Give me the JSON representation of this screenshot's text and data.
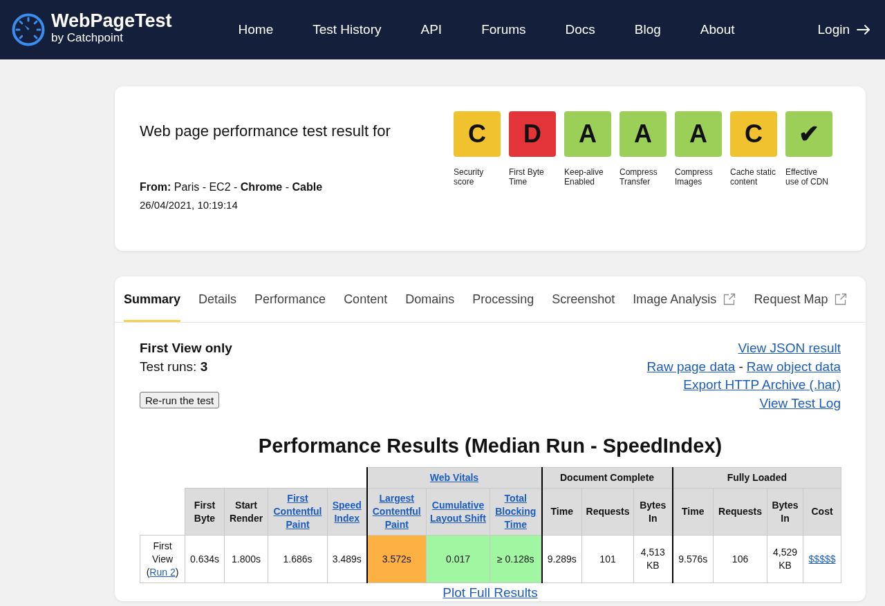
{
  "header": {
    "logo": {
      "title": "WebPageTest",
      "subtitle": "by Catchpoint"
    },
    "nav": [
      "Home",
      "Test History",
      "API",
      "Forums",
      "Docs",
      "Blog",
      "About"
    ],
    "login": "Login"
  },
  "summary": {
    "heading": "Web page performance test result for",
    "location": "**From:** Paris - EC2 - **Chrome** - **Cable**",
    "date": "26/04/2021, 10:19:14",
    "grades": [
      {
        "grade": "C",
        "label": "Security score",
        "color": "#f1c22f"
      },
      {
        "grade": "D",
        "label": "First Byte Time",
        "color": "#e3343a"
      },
      {
        "grade": "A",
        "label": "Keep-alive Enabled",
        "color": "#9ccf58"
      },
      {
        "grade": "A",
        "label": "Compress Transfer",
        "color": "#9ccf58"
      },
      {
        "grade": "A",
        "label": "Compress Images",
        "color": "#9ccf58"
      },
      {
        "grade": "C",
        "label": "Cache static content",
        "color": "#f1c22f"
      },
      {
        "grade": "✔",
        "label": "Effective use of CDN",
        "color": "#9ccf58"
      }
    ]
  },
  "tabs": [
    {
      "label": "Summary",
      "selected": true,
      "external": false
    },
    {
      "label": "Details",
      "selected": false,
      "external": false
    },
    {
      "label": "Performance",
      "selected": false,
      "external": false
    },
    {
      "label": "Content",
      "selected": false,
      "external": false
    },
    {
      "label": "Domains",
      "selected": false,
      "external": false
    },
    {
      "label": "Processing",
      "selected": false,
      "external": false
    },
    {
      "label": "Screenshot",
      "selected": false,
      "external": false
    },
    {
      "label": "Image Analysis",
      "selected": false,
      "external": true
    },
    {
      "label": "Request Map",
      "selected": false,
      "external": true
    }
  ],
  "summary_tab": {
    "view": "First View only",
    "runs": "Test runs: **3**",
    "rerun_button": "Re-run the test",
    "links": [
      {
        "items": [
          "View JSON result"
        ]
      },
      {
        "items": [
          "Raw page data",
          "Raw object data"
        ],
        "separator": "-"
      },
      {
        "items": [
          "Export HTTP Archive (.har)"
        ]
      },
      {
        "items": [
          "View Test Log"
        ]
      }
    ]
  },
  "results_table": {
    "title": "Performance Results (Median Run - SpeedIndex)",
    "column_groups": [
      {
        "columns": [
          {
            "label": "First Byte",
            "link": false
          },
          {
            "label": "Start Render",
            "link": false
          },
          {
            "label": "First Contentful Paint",
            "link": true
          },
          {
            "label": "Speed Index",
            "link": true
          }
        ]
      },
      {
        "label": "Web Vitals",
        "link": true,
        "columns": [
          {
            "label": "Largest Contentful Paint",
            "link": true
          },
          {
            "label": "Cumulative Layout Shift",
            "link": true
          },
          {
            "label": "Total Blocking Time",
            "link": true
          }
        ]
      },
      {
        "label": "Document Complete",
        "link": false,
        "columns": [
          {
            "label": "Time",
            "link": false
          },
          {
            "label": "Requests",
            "link": false
          },
          {
            "label": "Bytes In",
            "link": false
          }
        ]
      },
      {
        "label": "Fully Loaded",
        "link": false,
        "columns": [
          {
            "label": "Time",
            "link": false
          },
          {
            "label": "Requests",
            "link": false
          },
          {
            "label": "Bytes In",
            "link": false
          },
          {
            "label": "Cost",
            "link": false
          }
        ]
      }
    ],
    "rows": [
      {
        "label": "First View",
        "run_open": "(",
        "run_link": "Run 2",
        "run_close": ")",
        "cells": [
          {
            "text": "0.634s",
            "link": false
          },
          {
            "text": "1.800s",
            "link": false
          },
          {
            "text": "1.686s",
            "link": false
          },
          {
            "text": "3.489s",
            "link": false
          },
          {
            "text": "3.572s",
            "link": false,
            "color": "#fdb143"
          },
          {
            "text": "0.017",
            "link": false,
            "color": "#a1f7a1"
          },
          {
            "text": "≥ 0.128s",
            "link": false,
            "color": "#a1f7a1"
          },
          {
            "text": "9.289s",
            "link": false
          },
          {
            "text": "101",
            "link": false
          },
          {
            "text": "4,513 KB",
            "link": false
          },
          {
            "text": "9.576s",
            "link": false
          },
          {
            "text": "106",
            "link": false
          },
          {
            "text": "4,529 KB",
            "link": false
          },
          {
            "text": "$$$$$",
            "link": true
          }
        ]
      }
    ],
    "plot_link": "Plot Full Results"
  }
}
